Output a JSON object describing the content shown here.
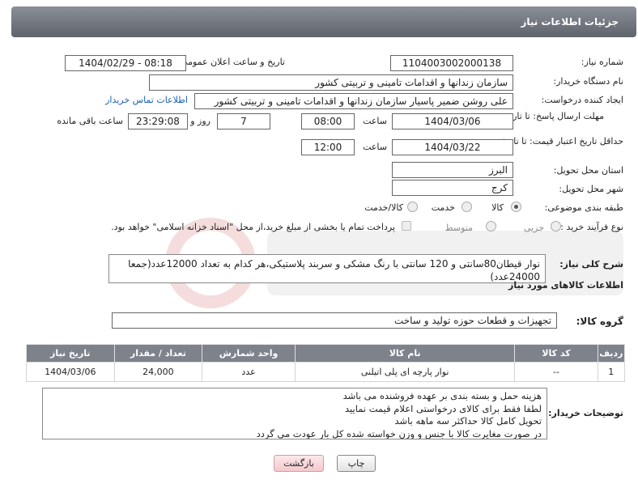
{
  "header": {
    "title": "جزئیات اطلاعات نیاز"
  },
  "fields": {
    "need_number": {
      "label": "شماره نیاز:",
      "value": "1104003002000138"
    },
    "announce": {
      "label": "تاریخ و ساعت اعلان عمومی:",
      "value": "1404/02/29 - 08:18"
    },
    "buyer_org": {
      "label": "نام دستگاه خریدار:",
      "value": "سازمان زندانها و اقدامات تامینی و تربیتی کشور"
    },
    "creator": {
      "label": "ایجاد کننده درخواست:",
      "value": "علی روشن ضمیر پاسیار سازمان زندانها و اقدامات تامینی و تربیتی کشور",
      "link": "اطلاعات تماس خریدار"
    },
    "deadline": {
      "label": "مهلت ارسال پاسخ: تا تاریخ:",
      "date": "1404/03/06",
      "time_label": "ساعت",
      "time": "08:00",
      "days": "7",
      "days_label": "روز و",
      "remaining": "23:29:08",
      "remaining_label": "ساعت باقی مانده"
    },
    "validity": {
      "label": "حداقل تاریخ اعتبار قیمت: تا تاریخ:",
      "date": "1404/03/22",
      "time_label": "ساعت",
      "time": "12:00"
    },
    "province": {
      "label": "استان محل تحویل:",
      "value": "البرز"
    },
    "city": {
      "label": "شهر محل تحویل:",
      "value": "کرج"
    },
    "category": {
      "label": "طبقه بندی موضوعی:",
      "options": [
        "کالا",
        "خدمت",
        "کالا/خدمت"
      ],
      "selected": "کالا"
    },
    "purchase_type": {
      "label": "نوع فرآیند خرید :",
      "options": [
        "جزیی",
        "متوسط"
      ],
      "note": "پرداخت تمام یا بخشی از مبلغ خرید،از محل \"اسناد خزانه اسلامی\" خواهد بود."
    }
  },
  "description": {
    "label": "شرح کلی نیاز:",
    "text": "نوار قیطان80سانتی و 120 سانتی با رنگ مشکی و سربند پلاستیکی،هر کدام به تعداد 12000عدد(جمعا 24000عدد)"
  },
  "goods_section": {
    "title": "اطلاعات کالاهای مورد نیاز",
    "group_label": "گروه کالا:",
    "group_value": "تجهیزات و قطعات حوزه تولید و ساخت",
    "columns": [
      "ردیف",
      "کد کالا",
      "نام کالا",
      "واحد شمارش",
      "تعداد / مقدار",
      "تاریخ نیاز"
    ],
    "rows": [
      {
        "row": "1",
        "code": "--",
        "name": "نوار پارچه ای پلی اتیلنی",
        "unit": "عدد",
        "qty": "24,000",
        "date": "1404/03/06"
      }
    ]
  },
  "buyer_notes": {
    "label": "توضیحات خریدار:",
    "lines": [
      "هزینه حمل و بسته بندی بر عهده فروشنده می باشد",
      "لطفا فقط برای کالای درخواستی اعلام قیمت نمایید",
      "تحویل کامل کالا حداکثر سه ماهه باشد",
      "در صورت مغایرت کالا با جنس و وزن خواسته شده کل بار عودت می گردد"
    ]
  },
  "buttons": {
    "print": "چاپ",
    "back": "بازگشت"
  },
  "colors": {
    "header_bg": "#6f747d",
    "table_head_bg": "#7d828b",
    "link": "#1a5fb4",
    "back_button": "#f3c9cd"
  }
}
